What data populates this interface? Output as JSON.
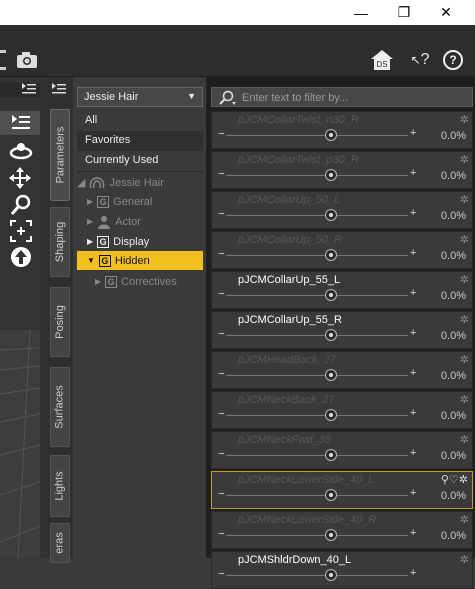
{
  "window": {
    "minimize_glyph": "—",
    "maximize_glyph": "❐",
    "close_glyph": "✕"
  },
  "toolbar": {
    "camera_icon": "camera-icon",
    "home_badge": "DS",
    "help_glyph": "?",
    "info_glyph": "?"
  },
  "tabs": {
    "parameters": "Parameters",
    "shaping": "Shaping",
    "posing": "Posing",
    "surfaces": "Surfaces",
    "lights": "Lights",
    "cameras": "eras"
  },
  "tree": {
    "node_select": "Jessie Hair",
    "items": [
      "All",
      "Favorites",
      "Currently Used"
    ],
    "root": "Jessie Hair",
    "groups": [
      {
        "label": "General",
        "dim": true
      },
      {
        "label": "Actor",
        "dim": true
      },
      {
        "label": "Display",
        "dim": false
      },
      {
        "label": "Hidden",
        "dim": false,
        "selected": true
      },
      {
        "label": "Correctives",
        "dim": true
      }
    ]
  },
  "filter": {
    "placeholder": "Enter text to filter by..."
  },
  "properties": [
    {
      "label": "pJCMCollarTwist_n30_R",
      "value": "0.0%",
      "hidden": true
    },
    {
      "label": "pJCMCollarTwist_p30_R",
      "value": "0.0%",
      "hidden": true
    },
    {
      "label": "pJCMCollarUp_50_L",
      "value": "0.0%",
      "hidden": true
    },
    {
      "label": "pJCMCollarUp_50_R",
      "value": "0.0%",
      "hidden": true
    },
    {
      "label": "pJCMCollarUp_55_L",
      "value": "0.0%",
      "hidden": false
    },
    {
      "label": "pJCMCollarUp_55_R",
      "value": "0.0%",
      "hidden": false
    },
    {
      "label": "pJCMHeadBack_27",
      "value": "0.0%",
      "hidden": true
    },
    {
      "label": "pJCMNeckBack_27",
      "value": "0.0%",
      "hidden": true
    },
    {
      "label": "pJCMNeckFwd_35",
      "value": "0.0%",
      "hidden": true
    },
    {
      "label": "pJCMNeckLowerSide_40_L",
      "value": "0.0%",
      "hidden": true,
      "highlighted": true
    },
    {
      "label": "pJCMNeckLowerSide_40_R",
      "value": "0.0%",
      "hidden": true
    },
    {
      "label": "pJCMShldrDown_40_L",
      "value": "",
      "hidden": false
    }
  ],
  "colors": {
    "accent": "#f4c020"
  }
}
